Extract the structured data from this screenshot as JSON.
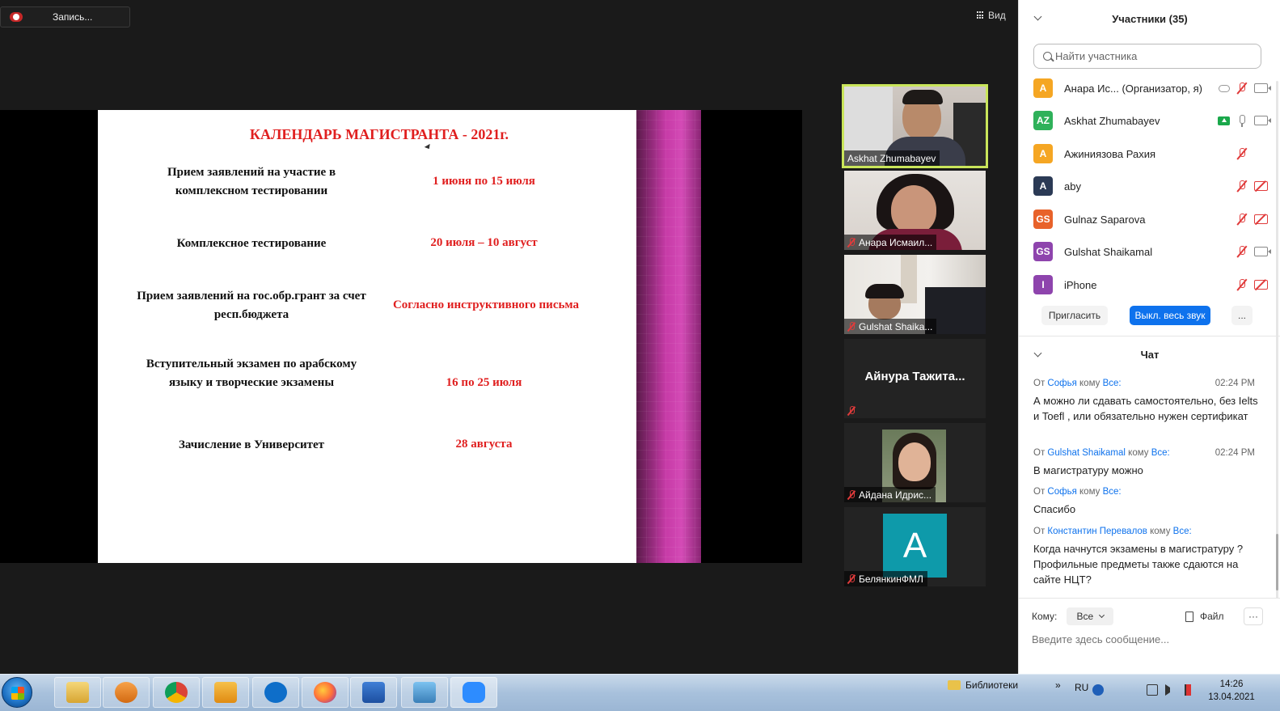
{
  "recording": {
    "label": "Запись..."
  },
  "view": {
    "label": "Вид"
  },
  "slide": {
    "title": "КАЛЕНДАРЬ МАГИСТРАНТА  - 2021г.",
    "rows": [
      {
        "label": "Прием заявлений на участие в комплексном тестировании",
        "value": "1 июня по 15 июля"
      },
      {
        "label": "Комплексное тестирование",
        "value": "20 июля – 10 август"
      },
      {
        "label": "Прием заявлений на гос.обр.грант за счет респ.бюджета",
        "value": "Согласно инструктивного  письма"
      },
      {
        "label": "Вступительный экзамен по арабскому языку и творческие экзамены",
        "value": "16 по 25 июля"
      },
      {
        "label": "Зачисление в Университет",
        "value": "28 августа"
      }
    ]
  },
  "tiles": [
    {
      "name": "Askhat Zhumabayev"
    },
    {
      "name": "Анара Исмаил..."
    },
    {
      "name": "Gulshat Shaika..."
    },
    {
      "name": "Айнура  Тажита..."
    },
    {
      "name": "Айдана Идрис..."
    },
    {
      "name": "БелянкинФМЛ",
      "initial": "A"
    }
  ],
  "participants": {
    "title": "Участники (35)",
    "search_placeholder": "Найти участника",
    "list": [
      {
        "initials": "A",
        "name": "Анара Ис... (Организатор, я)",
        "color": "#f5a623"
      },
      {
        "initials": "AZ",
        "name": "Askhat Zhumabayev",
        "color": "#2fb15a"
      },
      {
        "initials": "A",
        "name": " Ажиниязова Рахия",
        "color": "#f5a623"
      },
      {
        "initials": "A",
        "name": "aby",
        "color": "#2b3a55"
      },
      {
        "initials": "GS",
        "name": "Gulnaz Saparova",
        "color": "#e8622a"
      },
      {
        "initials": "GS",
        "name": "Gulshat Shaikamal",
        "color": "#8e44ad"
      },
      {
        "initials": "I",
        "name": "iPhone",
        "color": "#8e44ad"
      }
    ],
    "invite_label": "Пригласить",
    "mute_all_label": "Выкл. весь звук",
    "more_label": "..."
  },
  "chat": {
    "title": "Чат",
    "from_word": "От",
    "to_word": "кому",
    "messages": [
      {
        "from": "Софья",
        "to": "Все:",
        "time": "02:24 PM",
        "text": "А можно ли сдавать самостоятельно, без Ielts и Toefl , или обязательно нужен сертификат"
      },
      {
        "from": "Gulshat Shaikamal",
        "to": "Все:",
        "time": "02:24 PM",
        "text": "В магистратуру можно"
      },
      {
        "from": "Софья",
        "to": "Все:",
        "time": "",
        "text": "Спасибо"
      },
      {
        "from": "Константин Перевалов",
        "to": "Все:",
        "time": "",
        "text": "Когда начнутся экзамены в магистратуру ?Профильные предметы также сдаются на сайте НЦТ?"
      }
    ],
    "to_label": "Кому:",
    "to_value": "Все",
    "file_label": "Файл",
    "more_label": "···",
    "input_placeholder": "Введите здесь сообщение..."
  },
  "taskbar": {
    "libraries_label": "Библиотеки",
    "arrows": "»",
    "lang": "RU",
    "time": "14:26",
    "date": "13.04.2021"
  }
}
